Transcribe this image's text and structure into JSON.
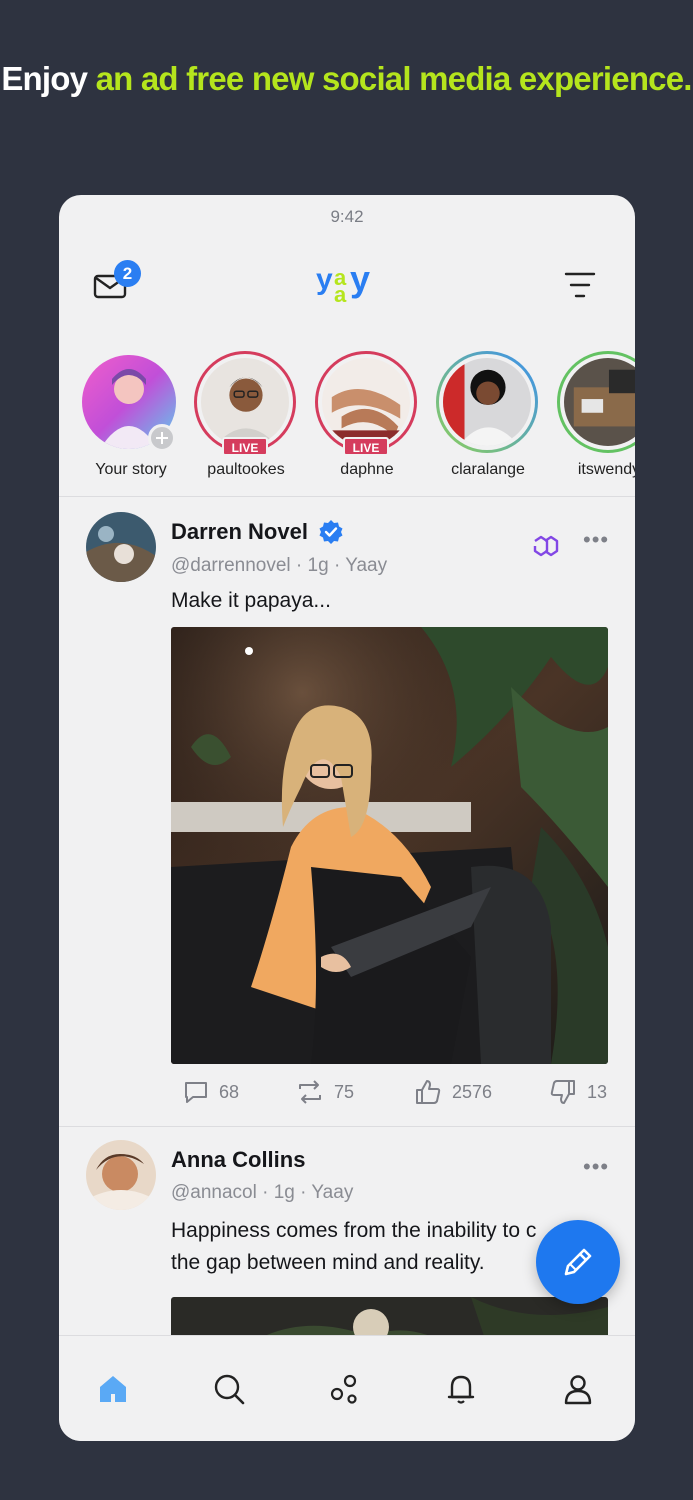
{
  "promo": {
    "headline_white": "Enjoy",
    "headline_green": "an ad free new social media experience."
  },
  "status_bar": {
    "time": "9:42"
  },
  "header": {
    "inbox_badge": "2",
    "logo_text": "yaay"
  },
  "stories": [
    {
      "name": "Your story",
      "live": false,
      "live_label": ""
    },
    {
      "name": "paultookes",
      "live": true,
      "live_label": "LIVE"
    },
    {
      "name": "daphne",
      "live": true,
      "live_label": "LIVE"
    },
    {
      "name": "claralange",
      "live": false,
      "live_label": ""
    },
    {
      "name": "itswendy",
      "live": false,
      "live_label": ""
    }
  ],
  "posts": [
    {
      "author": "Darren Novel",
      "verified": true,
      "handle": "@darrennovel",
      "time": "1g",
      "source": "Yaay",
      "text": "Make it papaya...",
      "stats": {
        "comments": "68",
        "reposts": "75",
        "likes": "2576",
        "dislikes": "13"
      }
    },
    {
      "author": "Anna Collins",
      "verified": false,
      "handle": "@annacol",
      "time": "1g",
      "source": "Yaay",
      "text_line1": "Happiness comes from the inability to c",
      "text_line2": "the gap between mind and reality."
    }
  ],
  "colors": {
    "accent_blue": "#1e78ef",
    "promo_green": "#b5e51d",
    "live_red": "#d53c5d",
    "bg_dark": "#2e3340"
  },
  "icons": [
    "mail-icon",
    "filter-icon",
    "verified-icon",
    "chain-link-icon",
    "comment-icon",
    "repost-icon",
    "like-icon",
    "dislike-icon",
    "pencil-icon",
    "home-icon",
    "search-icon",
    "network-icon",
    "bell-icon",
    "profile-icon"
  ]
}
